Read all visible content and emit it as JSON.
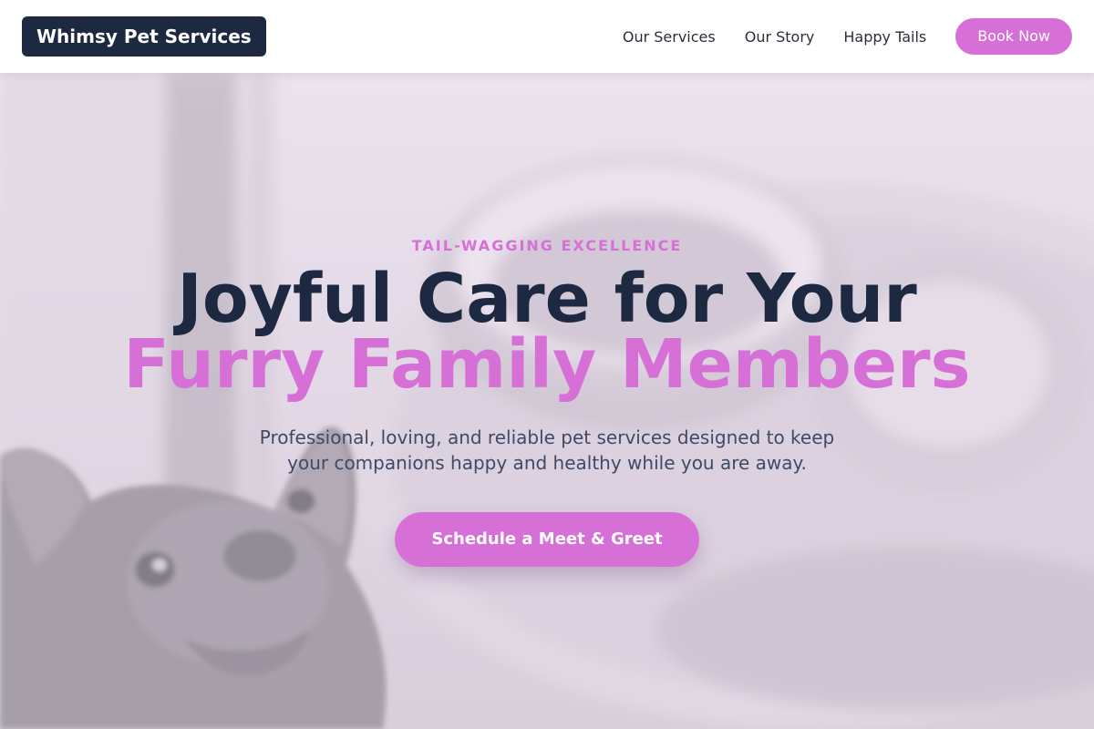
{
  "header": {
    "logo": "Whimsy Pet Services",
    "nav": [
      {
        "label": "Our Services"
      },
      {
        "label": "Our Story"
      },
      {
        "label": "Happy Tails"
      }
    ],
    "cta_label": "Book Now"
  },
  "hero": {
    "tagline": "TAIL-WAGGING EXCELLENCE",
    "headline_line1": "Joyful Care for Your",
    "headline_line2": "Furry Family Members",
    "subtitle": "Professional, loving, and reliable pet services designed to keep your companions happy and healthy while you are away.",
    "cta_label": "Schedule a Meet & Greet",
    "background_image": "french-bulldog-with-coffee-cup-photo"
  },
  "colors": {
    "accent": "#d66fd6",
    "navy": "#1d2940",
    "text_muted": "#3e4a66",
    "header_bg": "#ffffff"
  }
}
